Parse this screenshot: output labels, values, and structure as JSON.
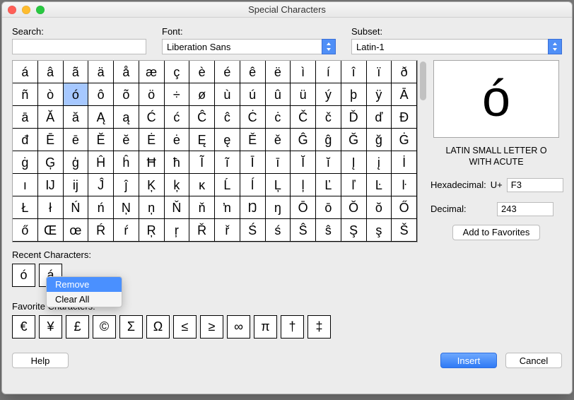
{
  "title": "Special Characters",
  "labels": {
    "search": "Search:",
    "font": "Font:",
    "subset": "Subset:",
    "recent": "Recent Characters:",
    "favorite": "Favorite Characters:",
    "hex": "Hexadecimal:",
    "hex_prefix": "U+",
    "dec": "Decimal:"
  },
  "search_value": "",
  "font_value": "Liberation Sans",
  "subset_value": "Latin-1",
  "grid": [
    "á",
    "â",
    "ã",
    "ä",
    "å",
    "æ",
    "ç",
    "è",
    "é",
    "ê",
    "ë",
    "ì",
    "í",
    "î",
    "ï",
    "ð",
    "ñ",
    "ò",
    "ó",
    "ô",
    "õ",
    "ö",
    "÷",
    "ø",
    "ù",
    "ú",
    "û",
    "ü",
    "ý",
    "þ",
    "ÿ",
    "Ā",
    "ā",
    "Ă",
    "ă",
    "Ą",
    "ą",
    "Ć",
    "ć",
    "Ĉ",
    "ĉ",
    "Ċ",
    "ċ",
    "Č",
    "č",
    "Ď",
    "ď",
    "Đ",
    "đ",
    "Ē",
    "ē",
    "Ĕ",
    "ĕ",
    "Ė",
    "ė",
    "Ę",
    "ę",
    "Ě",
    "ě",
    "Ĝ",
    "ĝ",
    "Ğ",
    "ğ",
    "Ġ",
    "ġ",
    "Ģ",
    "ģ",
    "Ĥ",
    "ĥ",
    "Ħ",
    "ħ",
    "Ĩ",
    "ĩ",
    "Ī",
    "ī",
    "Ĭ",
    "ĭ",
    "Į",
    "į",
    "İ",
    "ı",
    "Ĳ",
    "ĳ",
    "Ĵ",
    "ĵ",
    "Ķ",
    "ķ",
    "ĸ",
    "Ĺ",
    "ĺ",
    "Ļ",
    "ļ",
    "Ľ",
    "ľ",
    "Ŀ",
    "ŀ",
    "Ł",
    "ł",
    "Ń",
    "ń",
    "Ņ",
    "ņ",
    "Ň",
    "ň",
    "ŉ",
    "Ŋ",
    "ŋ",
    "Ō",
    "ō",
    "Ŏ",
    "ŏ",
    "Ő",
    "ő",
    "Œ",
    "œ",
    "Ŕ",
    "ŕ",
    "Ŗ",
    "ŗ",
    "Ř",
    "ř",
    "Ś",
    "ś",
    "Ŝ",
    "ŝ",
    "Ş",
    "ş",
    "Š"
  ],
  "selected_index": 18,
  "preview": {
    "glyph": "ó",
    "name": "LATIN SMALL LETTER O WITH ACUTE",
    "hex": "F3",
    "dec": "243"
  },
  "recent": [
    "ó",
    "á"
  ],
  "favorites": [
    "€",
    "¥",
    "£",
    "©",
    "Σ",
    "Ω",
    "≤",
    "≥",
    "∞",
    "π",
    "†",
    "‡"
  ],
  "context_menu": {
    "items": [
      "Remove",
      "Clear All"
    ],
    "hover_index": 0
  },
  "buttons": {
    "add_fav": "Add to Favorites",
    "help": "Help",
    "insert": "Insert",
    "cancel": "Cancel"
  }
}
